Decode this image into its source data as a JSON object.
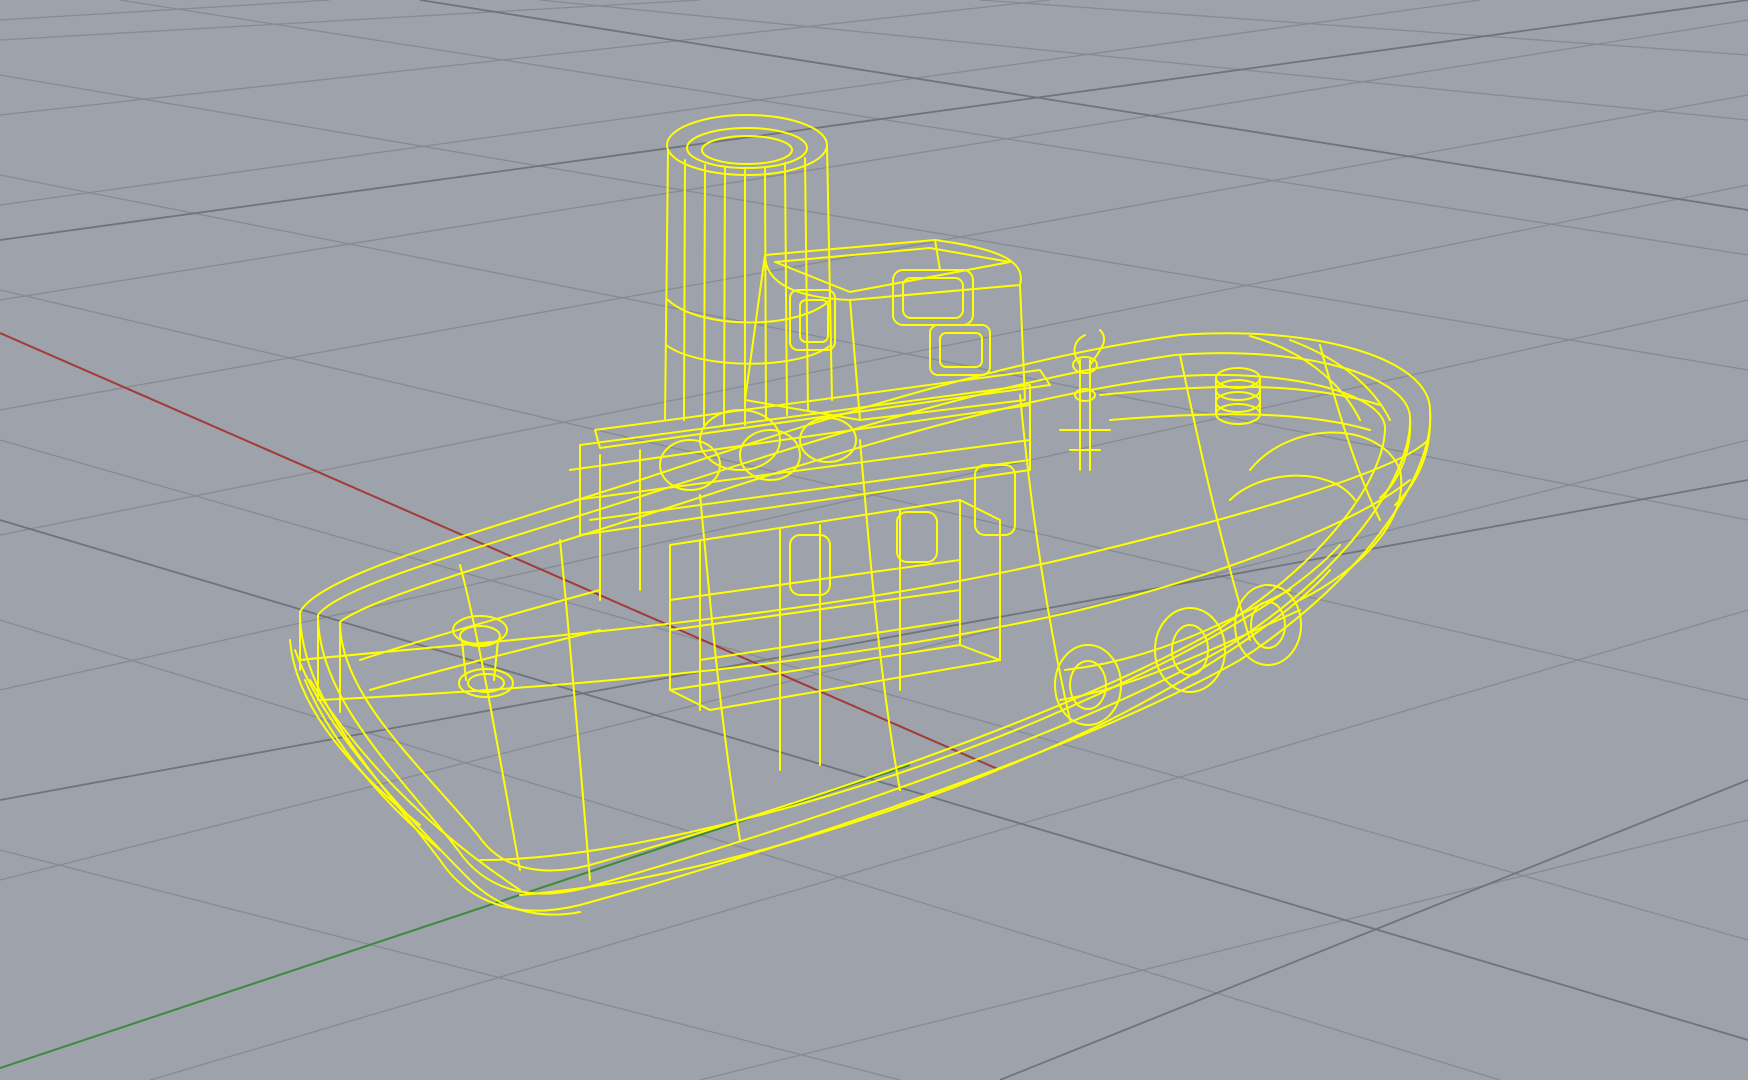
{
  "viewport": {
    "projection": "perspective",
    "display_mode": "wireframe",
    "background_color": "#9da2ab",
    "selection_color": "#ffff00",
    "grid_line_color": "#868b93",
    "grid_major_line_color": "#6f747c",
    "x_axis_color": "#a33a3a",
    "y_axis_color": "#3c8a3c"
  },
  "model": {
    "object": "tugboat",
    "selected": true,
    "parts": [
      "hull",
      "deck",
      "wheelhouse",
      "funnel",
      "bollard",
      "winch",
      "fenders",
      "mast"
    ]
  }
}
